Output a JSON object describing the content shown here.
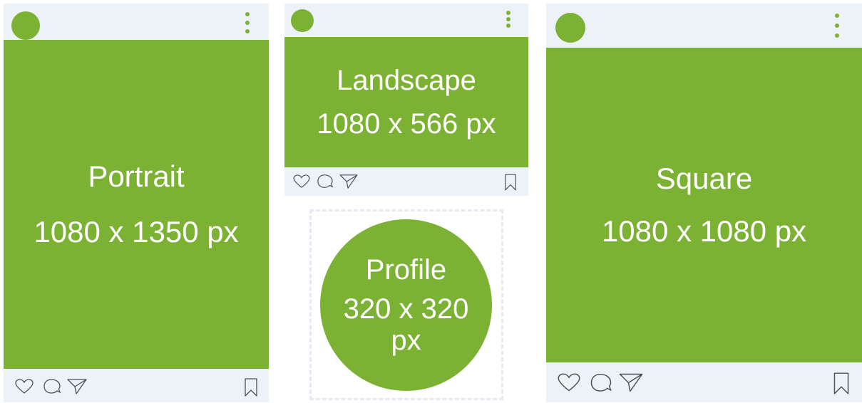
{
  "colors": {
    "accent_green": "#7cb233",
    "card_bg": "#edf1f8",
    "icon_stroke": "#4a4f5a",
    "frame_dash": "#e4e9f3"
  },
  "portrait": {
    "title": "Portrait",
    "size": "1080 x 1350 px"
  },
  "landscape": {
    "title": "Landscape",
    "size": "1080 x 566 px"
  },
  "profile": {
    "title": "Profile",
    "size": "320 x 320 px"
  },
  "square": {
    "title": "Square",
    "size": "1080 x 1080 px"
  },
  "icons": [
    "avatar",
    "more-vertical-icon",
    "heart-icon",
    "comment-icon",
    "share-icon",
    "bookmark-icon"
  ]
}
